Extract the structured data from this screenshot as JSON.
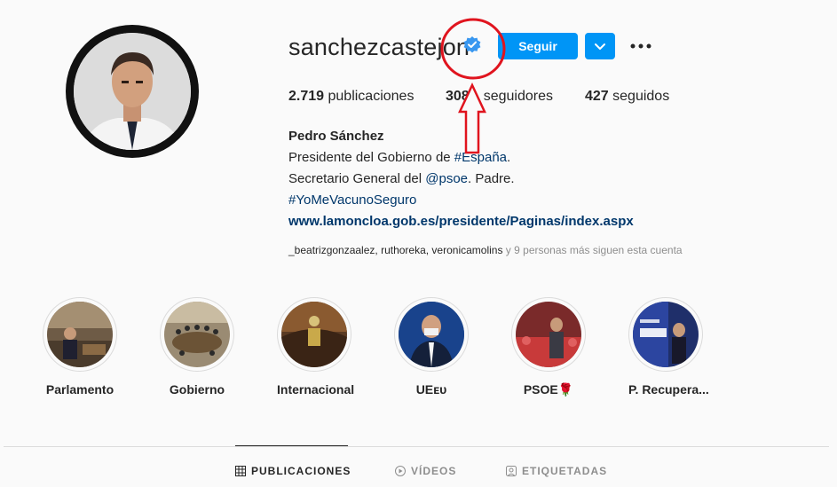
{
  "profile": {
    "username": "sanchezcastejon",
    "follow_label": "Seguir",
    "stats": {
      "posts_count": "2.719",
      "posts_label": "publicaciones",
      "followers_count": "308",
      "followers_label": "seguidores",
      "following_count": "427",
      "following_label": "seguidos"
    },
    "full_name": "Pedro Sánchez",
    "bio_line1_prefix": "Presidente del Gobierno de ",
    "bio_line1_tag": "#España",
    "bio_line1_suffix": ".",
    "bio_line2_prefix": "Secretario General del ",
    "bio_line2_mention": "@psoe",
    "bio_line2_suffix": ". Padre.",
    "bio_line3_tag": "#YoMeVacunoSeguro",
    "website": "www.lamoncloa.gob.es/presidente/Paginas/index.aspx",
    "followed_by_names": "_beatrizgonzaalez, ruthoreka, veronicamolins",
    "followed_by_suffix": " y 9 personas más siguen esta cuenta"
  },
  "highlights": [
    {
      "label": "Parlamento",
      "icon": "parliament-photo"
    },
    {
      "label": "Gobierno",
      "icon": "council-photo"
    },
    {
      "label": "Internacional",
      "icon": "assembly-photo"
    },
    {
      "label": "UEᴇᴜ",
      "icon": "portrait-photo"
    },
    {
      "label": "PSOE🌹",
      "icon": "rally-photo"
    },
    {
      "label": "P. Recupera...",
      "icon": "recovery-photo"
    }
  ],
  "tabs": [
    {
      "label": "PUBLICACIONES",
      "icon": "grid-icon",
      "active": true
    },
    {
      "label": "VÍDEOS",
      "icon": "play-icon",
      "active": false
    },
    {
      "label": "ETIQUETADAS",
      "icon": "tag-icon",
      "active": false
    }
  ],
  "colors": {
    "accent": "#0095f6",
    "verified": "#3897f0",
    "link": "#00376b",
    "annotation": "#e0141e"
  }
}
